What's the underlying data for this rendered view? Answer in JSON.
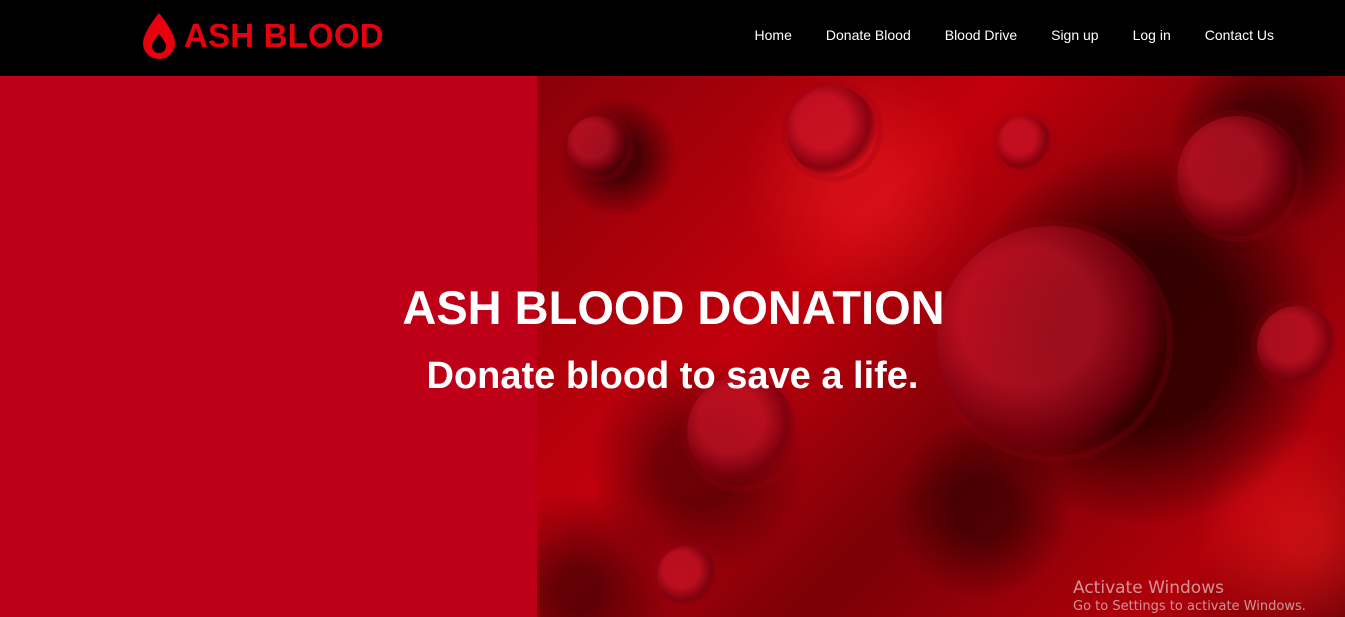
{
  "brand": {
    "name": "ASH BLOOD",
    "icon": "blood-drop-icon",
    "color": "#e8000f"
  },
  "nav": {
    "items": [
      {
        "label": "Home"
      },
      {
        "label": "Donate Blood"
      },
      {
        "label": "Blood Drive"
      },
      {
        "label": "Sign up"
      },
      {
        "label": "Log in"
      },
      {
        "label": "Contact Us"
      }
    ]
  },
  "hero": {
    "title": "ASH BLOOD DONATION",
    "subtitle": "Donate blood to save a life.",
    "accent_color": "#bd0018"
  },
  "watermark": {
    "title": "Activate Windows",
    "subtitle": "Go to Settings to activate Windows."
  }
}
